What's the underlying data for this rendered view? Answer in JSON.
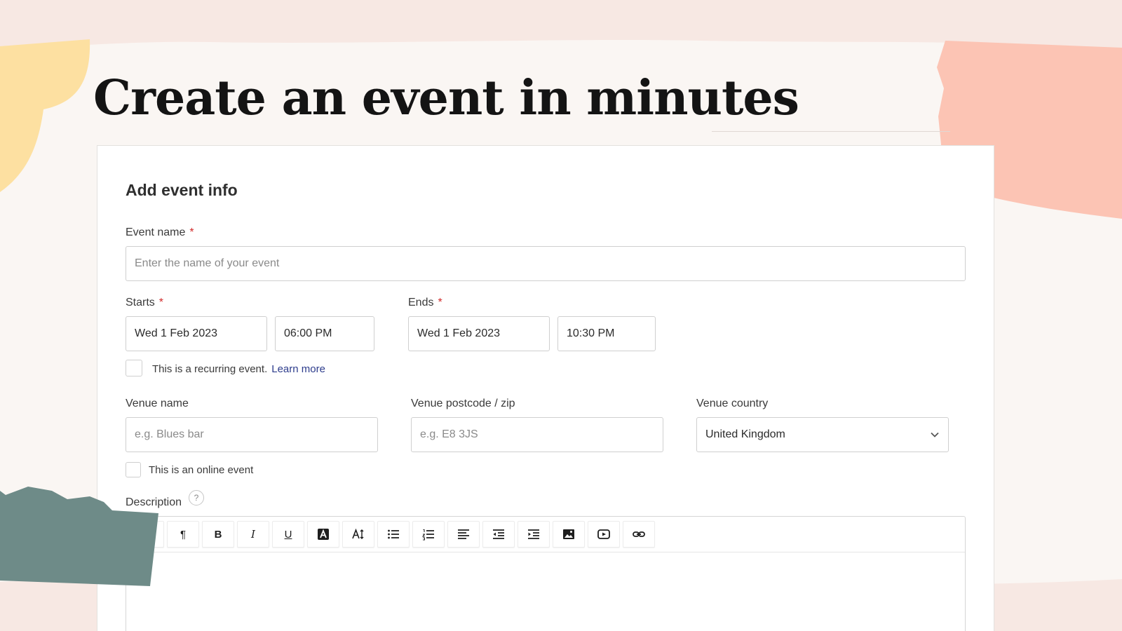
{
  "headline": "Create an event in minutes",
  "form": {
    "section_title": "Add event info",
    "required_mark": "*",
    "event_name": {
      "label": "Event name",
      "placeholder": "Enter the name of your event"
    },
    "starts": {
      "label": "Starts",
      "date": "Wed 1 Feb 2023",
      "time": "06:00 PM"
    },
    "ends": {
      "label": "Ends",
      "date": "Wed 1 Feb 2023",
      "time": "10:30 PM"
    },
    "recurring": {
      "label": "This is a recurring event.",
      "link": "Learn more"
    },
    "venue_name": {
      "label": "Venue name",
      "placeholder": "e.g. Blues bar"
    },
    "venue_postcode": {
      "label": "Venue postcode / zip",
      "placeholder": "e.g. E8 3JS"
    },
    "venue_country": {
      "label": "Venue country",
      "value": "United Kingdom"
    },
    "online": {
      "label": "This is an online event"
    },
    "description": {
      "label": "Description",
      "help": "?"
    }
  },
  "toolbar": [
    {
      "name": "paragraph-icon",
      "glyph": "¶"
    },
    {
      "name": "bold-icon",
      "glyph": "B"
    },
    {
      "name": "italic-icon",
      "glyph": "I"
    },
    {
      "name": "underline-icon",
      "glyph": "U"
    },
    {
      "name": "text-color-icon",
      "glyph": ""
    },
    {
      "name": "font-size-icon",
      "glyph": ""
    },
    {
      "name": "bullet-list-icon",
      "glyph": ""
    },
    {
      "name": "numbered-list-icon",
      "glyph": ""
    },
    {
      "name": "align-icon",
      "glyph": ""
    },
    {
      "name": "outdent-icon",
      "glyph": ""
    },
    {
      "name": "indent-icon",
      "glyph": ""
    },
    {
      "name": "image-icon",
      "glyph": ""
    },
    {
      "name": "video-icon",
      "glyph": ""
    },
    {
      "name": "link-icon",
      "glyph": ""
    }
  ],
  "colors": {
    "background": "#faf6f3",
    "band": "#f7e8e3",
    "blob_yellow": "#fde0a1",
    "blob_salmon": "#fcc4b4",
    "blob_teal": "#6e8b88",
    "required": "#d12b2b",
    "link": "#2d3c8c"
  }
}
